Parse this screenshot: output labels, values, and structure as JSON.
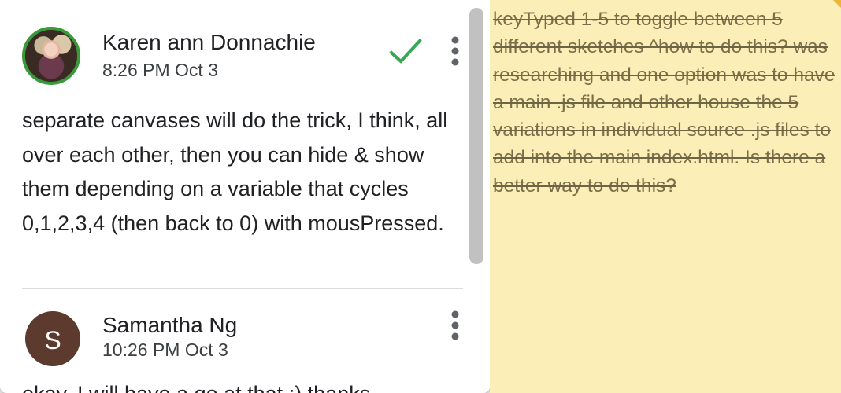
{
  "comments": [
    {
      "author": "Karen ann Donnachie",
      "timestamp": "8:26 PM Oct 3",
      "avatar_icon": "profile-photo",
      "body": "separate canvases will do the trick, I think, all over each other, then you can hide & show them depending on a variable that cycles 0,1,2,3,4 (then back to 0) with mousPressed."
    },
    {
      "author": "Samantha Ng",
      "timestamp": "10:26 PM Oct 3",
      "avatar_letter": "S",
      "body": "okay, I will have a go at that :) thanks"
    }
  ],
  "icons": {
    "resolve": "checkmark-icon",
    "more": "more-vert-icon"
  },
  "colors": {
    "resolve_check": "#34a853",
    "avatar_ring": "#3a9a3a",
    "avatar_letter_bg": "#5d3a2e",
    "sticky_note_bg": "#fbeeb6"
  },
  "sticky_note": {
    "text": "keyTyped 1-5 to toggle between 5 different sketches ^how to do this? was researching and one option was to have a main .js file and other house the 5 variations in individual source .js files to add into the main index.html. Is there a better way to do this?"
  }
}
